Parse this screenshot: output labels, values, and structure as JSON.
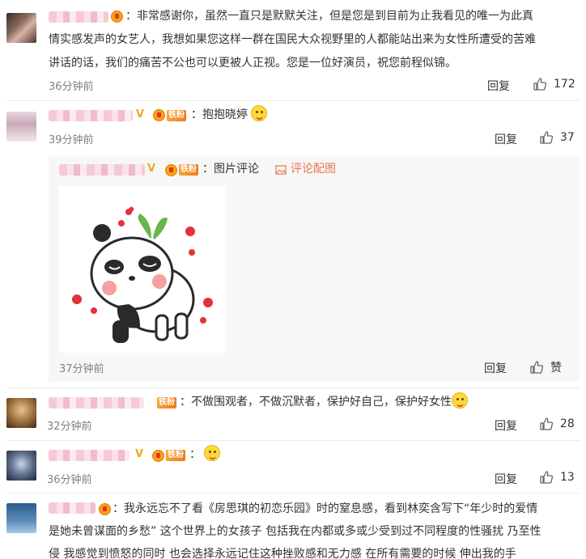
{
  "comments": [
    {
      "text": "：非常感谢你，虽然一直只是默默关注，但是您是到目前为止我看见的唯一为此真情实感发声的女艺人，我想如果您这样一群在国民大众视野里的人都能站出来为女性所遭受的苦难讲话的话，我们的痛苦不公也可以更被人正视。您是一位好演员，祝您前程似锦。",
      "line1": "：非常感谢你，虽然一直只是默默关注，但是您是到目前为止我看见的唯一为此真",
      "line2": "情实感发声的女艺人，我想如果您这样一群在国民大众视野里的人都能站出来为女性所遭受的苦难",
      "line3": "讲话的话，我们的痛苦不公也可以更被人正视。您是一位好演员，祝您前程似锦。",
      "time": "36分钟前",
      "reply_label": "回复",
      "likes": "172"
    },
    {
      "text": "：抱抱晓婷",
      "fan_badge": "铁粉",
      "time": "39分钟前",
      "reply_label": "回复",
      "likes": "37"
    },
    {
      "fan_badge": "铁粉",
      "text": "：图片评论",
      "image_comment_link": "评论配图",
      "time": "37分钟前",
      "reply_label": "回复",
      "like_label": "赞"
    },
    {
      "fan_badge": "铁粉",
      "text": "：不做围观者，不做沉默者，保护好自己，保护好女性",
      "time": "32分钟前",
      "reply_label": "回复",
      "likes": "28"
    },
    {
      "fan_badge": "铁粉",
      "text": "：",
      "time": "36分钟前",
      "reply_label": "回复",
      "likes": "13"
    },
    {
      "line1": "：我永远忘不了看《房思琪的初恋乐园》时的窒息感，看到林奕含写下“年少时的爱情",
      "line2": "是她未曾谋面的乡愁” 这个世界上的女孩子 包括我在内都或多或少受到过不同程度的性骚扰 乃至性",
      "line3": "侵 我感觉到愤怒的同时 也会选择永远记住这种挫败感和无力感 在所有需要的时候 伸出我的手"
    }
  ],
  "icons": {
    "like": "thumbs-up-icon",
    "image": "picture-icon",
    "vip": "vip-v-icon",
    "medal": "medal-icon"
  },
  "colors": {
    "link": "#eb7350",
    "badge": "#f07b1a",
    "muted": "#808080"
  }
}
